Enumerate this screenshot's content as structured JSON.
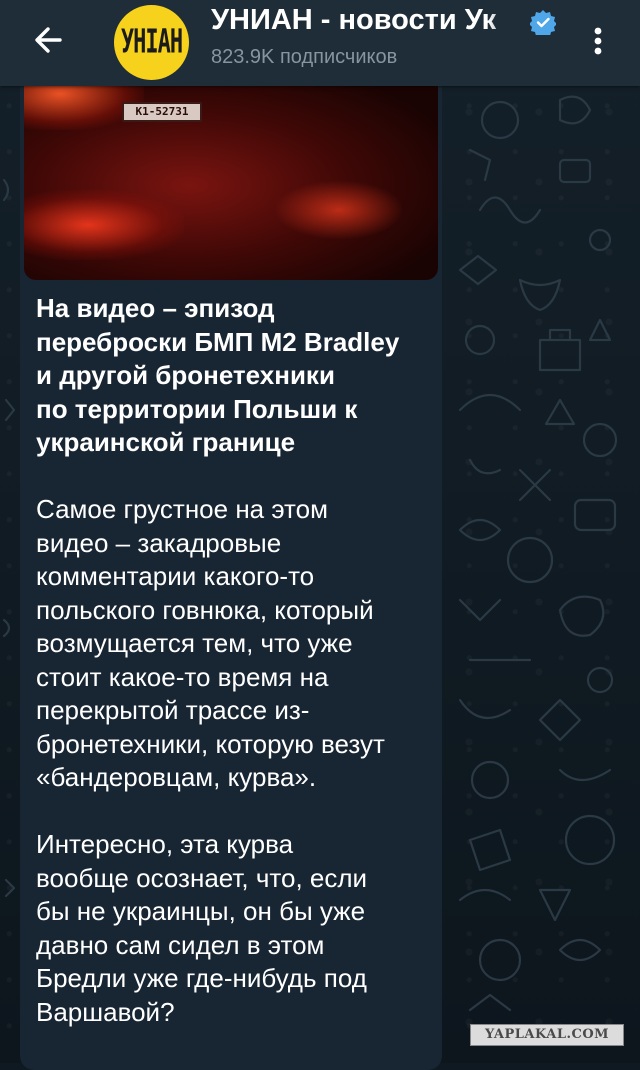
{
  "header": {
    "channel_title": "УНИАН - новости Ук",
    "subscribers": "823.9K подписчиков",
    "avatar_text": "УНІАН",
    "back_icon": "arrow-left-icon",
    "verified_icon": "verified-badge-icon",
    "more_icon": "more-vertical-icon"
  },
  "message": {
    "media": {
      "type": "video-thumbnail",
      "plate_text": "K1-52731"
    },
    "headline": "На видео – эпизод\nпереброски БМП М2 Bradley\nи другой бронетехники\nпо территории Польши к\nукраинской границе",
    "paragraph_1": "Самое грустное на этом\nвидео – закадровые\nкомментарии какого-то\nпольского говнюка, который\nвозмущается тем, что уже\nстоит какое-то время на\nперекрытой трассе из-\nбронетехники, которую везут\n«бандеровцам, курва».",
    "paragraph_2": "Интересно, эта курва\nвообще осознает, что, если\nбы не украинцы, он бы уже\nдавно сам сидел в этом\nБредли уже где-нибудь под\nВаршавой?"
  },
  "watermark": "YAPLAKAL.COM",
  "colors": {
    "header_bg": "#1f2d38",
    "bubble_bg": "#182533",
    "chat_bg": "#0f1921",
    "subtitle_text": "#8795a1",
    "verified": "#4fa6e8",
    "avatar_bg": "#f6d21d"
  }
}
